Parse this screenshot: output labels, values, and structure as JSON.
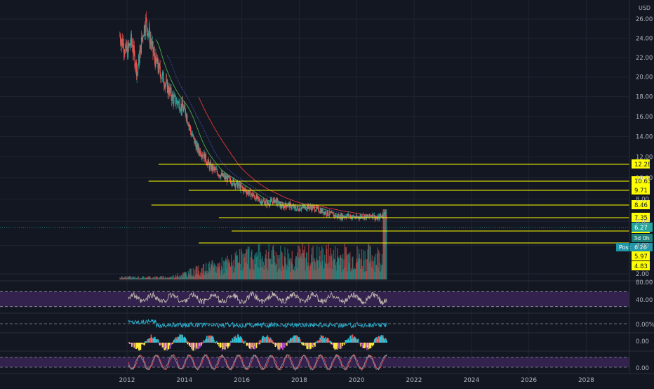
{
  "chart_data": {
    "type": "candlestick",
    "currency": "USD",
    "price_axis": {
      "scale": "log",
      "ticks": [
        "26.00",
        "24.00",
        "22.00",
        "20.00",
        "18.00",
        "16.00",
        "14.00",
        "12.00",
        "10.00",
        "8.00",
        "6.00",
        "4.00",
        "2.00"
      ],
      "tick_values": [
        26,
        24,
        22,
        20,
        18,
        16,
        14,
        12,
        10,
        8,
        6,
        4,
        2
      ]
    },
    "time_axis": {
      "ticks": [
        "2012",
        "2014",
        "2016",
        "2018",
        "2020",
        "2022",
        "2024",
        "2026",
        "2028"
      ],
      "tick_years": [
        2012,
        2014,
        2016,
        2018,
        2020,
        2022,
        2024,
        2026,
        2028
      ],
      "range_years": [
        2010.7,
        2030.0
      ]
    },
    "price_series": {
      "anchors_year": [
        2011.75,
        2012.0,
        2012.15,
        2012.35,
        2012.55,
        2012.65,
        2012.8,
        2012.95,
        2013.15,
        2013.4,
        2013.6,
        2013.85,
        2014.05,
        2014.25,
        2014.45,
        2014.65,
        2014.85,
        2015.1,
        2015.4,
        2015.7,
        2016.0,
        2016.3,
        2016.6,
        2016.9,
        2017.15,
        2017.4,
        2017.6,
        2017.9,
        2018.2,
        2018.5,
        2018.8,
        2019.1,
        2019.4,
        2019.7,
        2020.0,
        2020.2,
        2020.4,
        2020.55,
        2020.7,
        2020.85,
        2021.0,
        2021.05
      ],
      "anchors_price": [
        24.2,
        22.5,
        23.8,
        20.5,
        24.5,
        25.8,
        24.0,
        22.0,
        20.5,
        19.0,
        17.8,
        17.2,
        16.4,
        14.2,
        12.8,
        12.3,
        11.2,
        10.6,
        10.0,
        9.6,
        9.0,
        8.5,
        7.9,
        7.6,
        7.9,
        7.3,
        7.5,
        7.1,
        7.3,
        7.2,
        6.9,
        6.6,
        6.4,
        6.5,
        6.3,
        6.5,
        6.35,
        6.6,
        6.2,
        6.5,
        6.7,
        6.3
      ]
    },
    "moving_averages": [
      {
        "color": "#4caf50",
        "start_year": 2013.0,
        "end_year": 2021.05,
        "lag": 0.5
      },
      {
        "color": "#3f51b5",
        "start_year": 2013.4,
        "end_year": 2021.05,
        "lag": 0.9
      },
      {
        "color": "#e53935",
        "start_year": 2014.5,
        "end_year": 2021.05,
        "lag": 1.7
      }
    ],
    "horizontal_levels": [
      {
        "label": "12.28",
        "value": 12.28,
        "start_year": 2013.1
      },
      {
        "label": "10.63",
        "value": 10.63,
        "start_year": 2012.75
      },
      {
        "label": "9.71",
        "value": 9.71,
        "start_year": 2014.15
      },
      {
        "label": "8.46",
        "value": 8.46,
        "start_year": 2012.85
      },
      {
        "label": "7.35",
        "value": 7.35,
        "start_year": 2015.2
      },
      {
        "label": "6.27",
        "value": 6.27,
        "start_year": 2015.65
      },
      {
        "label": "5.97",
        "value": 5.97,
        "start_year": 2014.5
      },
      {
        "label": "4.83",
        "value": 4.83,
        "start_year": 2014.5
      }
    ],
    "last_price": {
      "label": "6.27",
      "value": 6.27,
      "color": "#26a69a"
    },
    "countdown_label": "3d 0h",
    "post_market": {
      "tag": "Post",
      "label": "6.26"
    },
    "volume": {
      "start_year": 2011.75,
      "end_year": 2021.05,
      "spike_year": 2021.0
    },
    "indicators": [
      {
        "name": "rsi",
        "ticks": [
          "80.00",
          "40.00"
        ],
        "tick_values": [
          80,
          40
        ],
        "range": [
          20,
          95
        ],
        "band": [
          30,
          70
        ],
        "color": "#c9c3b4",
        "band_fill": "#3a2455"
      },
      {
        "name": "oscillator",
        "ticks": [
          "0.00%"
        ],
        "tick_values": [
          0
        ],
        "range": [
          -4,
          4
        ],
        "color": "#2ab7d6"
      },
      {
        "name": "histogram",
        "ticks": [
          "0.00"
        ],
        "tick_values": [
          0
        ],
        "range": [
          -1,
          1
        ],
        "colors": [
          "#26c6da",
          "#ffeb3b",
          "#ef5350",
          "#ab47bc"
        ]
      },
      {
        "name": "stochastic",
        "ticks": [
          "0.00"
        ],
        "tick_values": [
          0
        ],
        "range": [
          -10,
          110
        ],
        "band": [
          20,
          80
        ],
        "colors": [
          "#ef5350",
          "#8e99ab"
        ],
        "band_fill": "#3a2455"
      }
    ]
  },
  "colors": {
    "background": "#131722",
    "grid": "#1f2433",
    "up": "#26a69a",
    "down": "#ef5350",
    "level_line": "#ffff00",
    "axis_text": "#b2b5be"
  }
}
